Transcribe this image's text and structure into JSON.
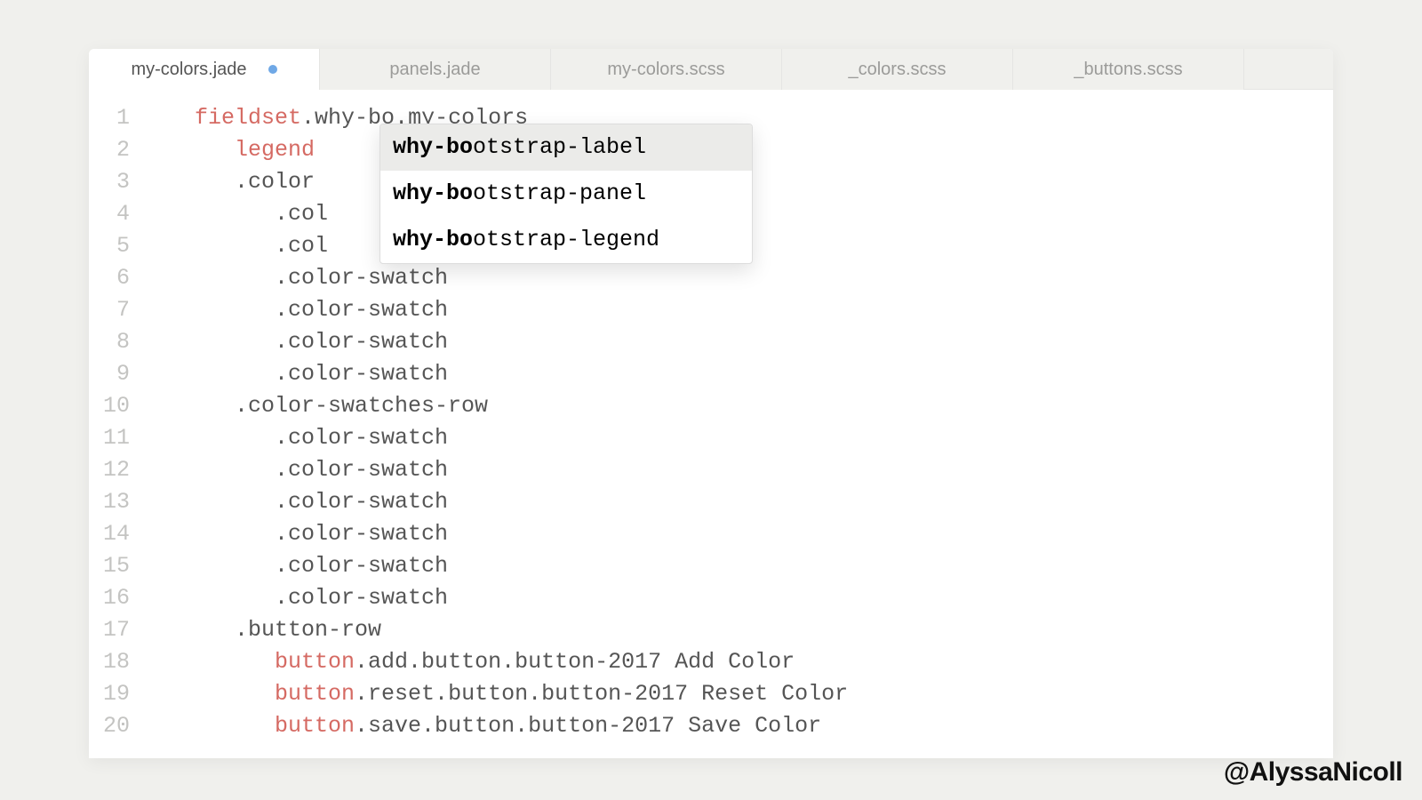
{
  "tabs": [
    {
      "label": "my-colors.jade",
      "active": true,
      "dirty": true
    },
    {
      "label": "panels.jade",
      "active": false,
      "dirty": false
    },
    {
      "label": "my-colors.scss",
      "active": false,
      "dirty": false
    },
    {
      "label": "_colors.scss",
      "active": false,
      "dirty": false
    },
    {
      "label": "_buttons.scss",
      "active": false,
      "dirty": false
    }
  ],
  "gutter": [
    "1",
    "2",
    "3",
    "4",
    "5",
    "6",
    "7",
    "8",
    "9",
    "10",
    "11",
    "12",
    "13",
    "14",
    "15",
    "16",
    "17",
    "18",
    "19",
    "20"
  ],
  "lines": [
    {
      "indent": 0,
      "tag": "fieldset",
      "rest": ".why-bo.my-colors"
    },
    {
      "indent": 1,
      "tag": "legend",
      "rest": ""
    },
    {
      "indent": 1,
      "tag": "",
      "rest": ".color"
    },
    {
      "indent": 2,
      "tag": "",
      "rest": ".col"
    },
    {
      "indent": 2,
      "tag": "",
      "rest": ".col"
    },
    {
      "indent": 2,
      "tag": "",
      "rest": ".color-swatch"
    },
    {
      "indent": 2,
      "tag": "",
      "rest": ".color-swatch"
    },
    {
      "indent": 2,
      "tag": "",
      "rest": ".color-swatch"
    },
    {
      "indent": 2,
      "tag": "",
      "rest": ".color-swatch"
    },
    {
      "indent": 1,
      "tag": "",
      "rest": ".color-swatches-row"
    },
    {
      "indent": 2,
      "tag": "",
      "rest": ".color-swatch"
    },
    {
      "indent": 2,
      "tag": "",
      "rest": ".color-swatch"
    },
    {
      "indent": 2,
      "tag": "",
      "rest": ".color-swatch"
    },
    {
      "indent": 2,
      "tag": "",
      "rest": ".color-swatch"
    },
    {
      "indent": 2,
      "tag": "",
      "rest": ".color-swatch"
    },
    {
      "indent": 2,
      "tag": "",
      "rest": ".color-swatch"
    },
    {
      "indent": 1,
      "tag": "",
      "rest": ".button-row"
    },
    {
      "indent": 2,
      "tag": "button",
      "rest": ".add.button.button-2017 Add Color"
    },
    {
      "indent": 2,
      "tag": "button",
      "rest": ".reset.button.button-2017 Reset Color"
    },
    {
      "indent": 2,
      "tag": "button",
      "rest": ".save.button.button-2017 Save Color"
    }
  ],
  "autocomplete": {
    "query": "why-bo",
    "items": [
      {
        "match": "why-bo",
        "suffix": "otstrap-label",
        "selected": true
      },
      {
        "match": "why-bo",
        "suffix": "otstrap-panel",
        "selected": false
      },
      {
        "match": "why-bo",
        "suffix": "otstrap-legend",
        "selected": false
      }
    ]
  },
  "credit": "@AlyssaNicoll"
}
